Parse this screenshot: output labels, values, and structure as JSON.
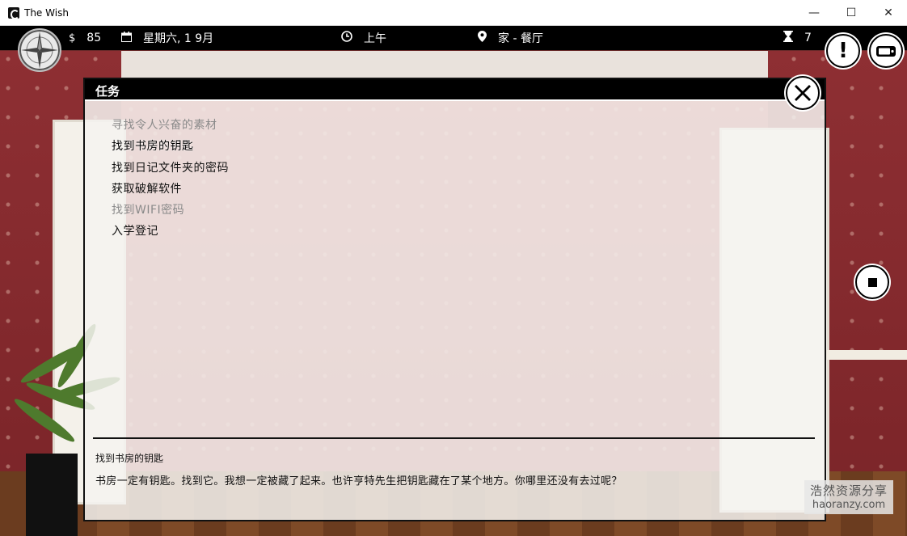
{
  "window": {
    "title": "The Wish",
    "controls": {
      "minimize": "—",
      "maximize": "☐",
      "close": "✕"
    }
  },
  "hud": {
    "money": "85",
    "date": "星期六, 1 9月",
    "time": "上午",
    "location": "家 - 餐厅",
    "turns": "7",
    "icons": {
      "money": "dollar-icon",
      "date": "calendar-icon",
      "time": "clock-icon",
      "location": "map-pin-icon",
      "turns": "hourglass-icon"
    }
  },
  "buttons": {
    "alert": "!",
    "compass": "compass-icon",
    "phone": "phone-icon",
    "stop": "stop-icon"
  },
  "panel": {
    "title": "任务",
    "tasks": [
      {
        "label": "寻找令人兴奋的素材",
        "state": "done"
      },
      {
        "label": "找到书房的钥匙",
        "state": "selected"
      },
      {
        "label": "找到日记文件夹的密码",
        "state": "active"
      },
      {
        "label": "获取破解软件",
        "state": "active"
      },
      {
        "label": "找到WIFI密码",
        "state": "done"
      },
      {
        "label": "入学登记",
        "state": "active"
      }
    ],
    "detail": {
      "title": "找到书房的钥匙",
      "description": "书房一定有钥匙。找到它。我想一定被藏了起来。也许亨特先生把钥匙藏在了某个地方。你哪里还没有去过呢？"
    }
  },
  "watermark": {
    "line1": "浩然资源分享",
    "line2": "haoranzy.com"
  },
  "colors": {
    "hud_bg": "#000000",
    "panel_bg": "#f5f3f0",
    "wall": "#9d3a40",
    "done_text": "#8a8a8a"
  }
}
